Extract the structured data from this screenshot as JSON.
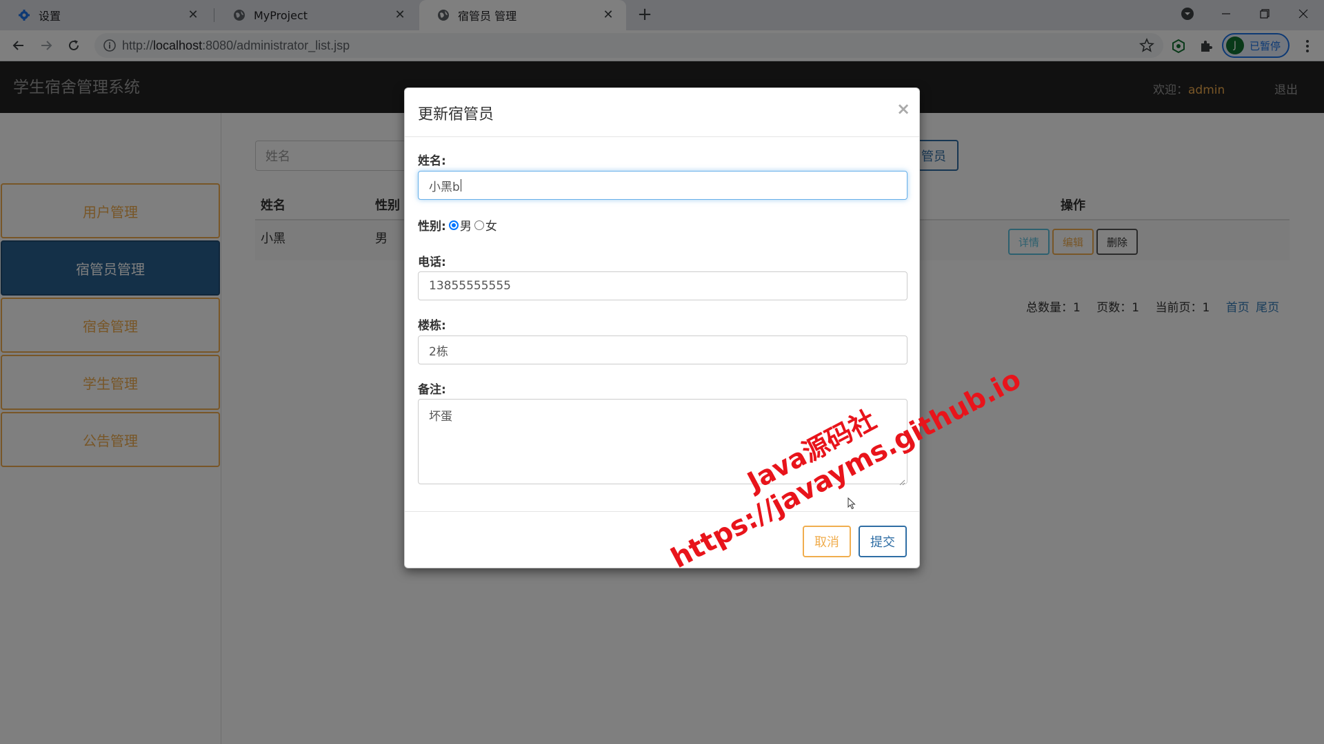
{
  "browser": {
    "tabs": [
      {
        "title": "设置",
        "icon": "gear-icon"
      },
      {
        "title": "MyProject",
        "icon": "globe-icon"
      },
      {
        "title": "宿管员 管理",
        "icon": "globe-icon"
      }
    ],
    "url_prefix": "http://",
    "url_host": "localhost",
    "url_rest": ":8080/administrator_list.jsp",
    "profile_initial": "J",
    "profile_label": "已暂停"
  },
  "app": {
    "title": "学生宿舍管理系统",
    "welcome_label": "欢迎：",
    "username": "admin",
    "logout": "退出"
  },
  "sidebar": {
    "items": [
      {
        "label": "用户管理"
      },
      {
        "label": "宿管员管理",
        "active": true
      },
      {
        "label": "宿舍管理"
      },
      {
        "label": "学生管理"
      },
      {
        "label": "公告管理"
      }
    ]
  },
  "content": {
    "search_placeholder": "姓名",
    "add_button": "管员",
    "table": {
      "headers": {
        "name": "姓名",
        "gender": "性别",
        "actions": "操作"
      },
      "rows": [
        {
          "name": "小黑",
          "gender": "男"
        }
      ],
      "buttons": {
        "detail": "详情",
        "edit": "编辑",
        "delete": "删除"
      }
    },
    "pager": {
      "total": "总数量：1",
      "pages": "页数：1",
      "current": "当前页：1",
      "first": "首页",
      "last": "尾页"
    }
  },
  "modal": {
    "title": "更新宿管员",
    "close": "×",
    "name_label": "姓名:",
    "name_value": "小黑b",
    "gender_label": "性别:",
    "gender_male": "男",
    "gender_female": "女",
    "phone_label": "电话:",
    "phone_value": "13855555555",
    "building_label": "楼栋:",
    "building_value": "2栋",
    "remark_label": "备注:",
    "remark_value": "坏蛋",
    "cancel": "取消",
    "submit": "提交"
  },
  "watermark": {
    "line1": "Java源码社",
    "line2": "https://javayms.github.io"
  }
}
